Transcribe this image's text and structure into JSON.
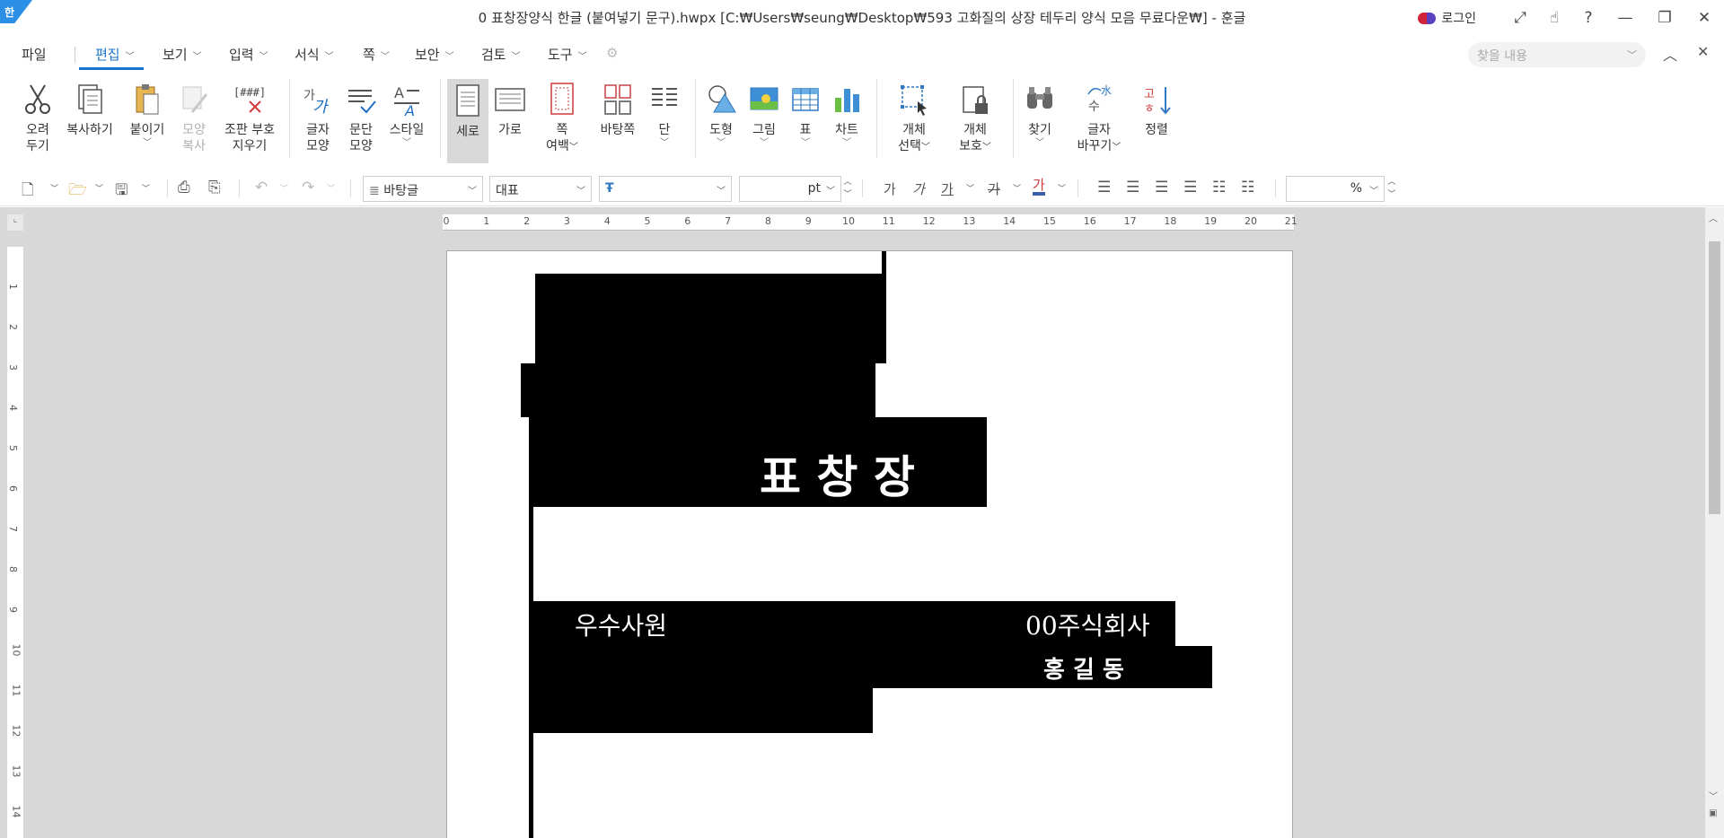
{
  "titlebar": {
    "app_logo": "한",
    "title": "0 표창장양식 한글 (붙여넣기 문구).hwpx [C:₩Users₩seung₩Desktop₩593 고화질의 상장 테두리 양식 모음 무료다운₩] - 훈글",
    "login_label": "로그인",
    "icons": [
      "expand-icon",
      "hand-icon",
      "help-icon",
      "minimize-icon",
      "restore-icon",
      "close-icon"
    ]
  },
  "menubar": {
    "items": [
      "파일",
      "편집",
      "보기",
      "입력",
      "서식",
      "쪽",
      "보안",
      "검토",
      "도구"
    ],
    "active": "편집",
    "search_placeholder": "찾을 내용"
  },
  "ribbon": {
    "buttons": [
      {
        "label1": "오려",
        "label2": "두기"
      },
      {
        "label1": "복사하기",
        "label2": ""
      },
      {
        "label1": "붙이기",
        "label2": ""
      },
      {
        "label1": "모양",
        "label2": "복사"
      },
      {
        "label1": "조판 부호",
        "label2": "지우기"
      },
      {
        "label1": "글자",
        "label2": "모양"
      },
      {
        "label1": "문단",
        "label2": "모양"
      },
      {
        "label1": "스타일",
        "label2": ""
      },
      {
        "label1": "세로",
        "label2": ""
      },
      {
        "label1": "가로",
        "label2": ""
      },
      {
        "label1": "쪽",
        "label2": "여백"
      },
      {
        "label1": "바탕쪽",
        "label2": ""
      },
      {
        "label1": "단",
        "label2": ""
      },
      {
        "label1": "도형",
        "label2": ""
      },
      {
        "label1": "그림",
        "label2": ""
      },
      {
        "label1": "표",
        "label2": ""
      },
      {
        "label1": "차트",
        "label2": ""
      },
      {
        "label1": "개체",
        "label2": "선택"
      },
      {
        "label1": "개체",
        "label2": "보호"
      },
      {
        "label1": "찾기",
        "label2": ""
      },
      {
        "label1": "글자",
        "label2": "바꾸기"
      },
      {
        "label1": "정렬",
        "label2": ""
      }
    ]
  },
  "format_toolbar": {
    "style": "바탕글",
    "font_lang": "대표",
    "font_name": "",
    "font_size_unit": "pt",
    "zoom_unit": "%",
    "char_glyphs": [
      "가",
      "가",
      "가",
      "가",
      "가"
    ]
  },
  "ruler": {
    "h_ticks": [
      "0",
      "1",
      "2",
      "3",
      "4",
      "5",
      "6",
      "7",
      "8",
      "9",
      "10",
      "11",
      "12",
      "13",
      "14",
      "15",
      "16",
      "17",
      "18",
      "19",
      "20",
      "21"
    ],
    "v_ticks": [
      "1",
      "2",
      "3",
      "4",
      "5",
      "6",
      "7",
      "8",
      "9",
      "10",
      "11",
      "12",
      "13",
      "14"
    ]
  },
  "document": {
    "title": "표  창  장",
    "label_left": "우수사원",
    "company": "00주식회사",
    "name": "홍  길  동"
  },
  "colors": {
    "accent": "#1a73c9",
    "workspace": "#d8d8d8",
    "redaction": "#000000"
  }
}
